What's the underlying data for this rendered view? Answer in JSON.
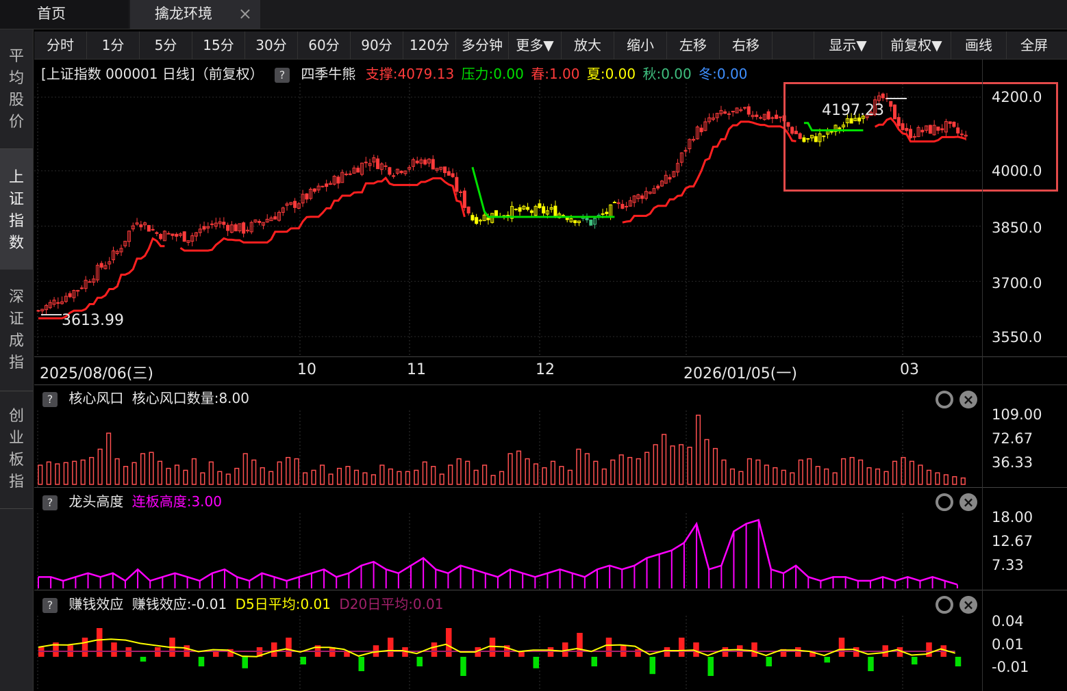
{
  "tabs": {
    "home": "首页",
    "active": "擒龙环境",
    "close": "×"
  },
  "leftnav": {
    "item1": [
      "平",
      "均",
      "股",
      "价"
    ],
    "item2": [
      "上",
      "证",
      "指",
      "数"
    ],
    "item3": [
      "深",
      "证",
      "成",
      "指"
    ],
    "item4": [
      "创",
      "业",
      "板",
      "指"
    ]
  },
  "toolbar": [
    "分时",
    "1分",
    "5分",
    "15分",
    "30分",
    "60分",
    "90分",
    "120分",
    "多分钟",
    "更多▼",
    "放大",
    "缩小",
    "左移",
    "右移",
    "",
    "显示▼",
    "前复权▼",
    "画线",
    "全屏"
  ],
  "main": {
    "title": "[上证指数 000001 日线]（前复权）",
    "indicator": "四季牛熊",
    "support": "支撑:4079.13",
    "pressure": "压力:0.00",
    "spring": "春:1.00",
    "summer": "夏:0.00",
    "autumn": "秋:0.00",
    "winter": "冬:0.00",
    "high_label": "4197.23",
    "low_label": "3613.99",
    "y_ticks": [
      "4200.0",
      "4000.0",
      "3850.0",
      "3700.0",
      "3550.0"
    ],
    "dates": [
      "2025/08/06(三)",
      "10",
      "11",
      "12",
      "2026/01/05(一)",
      "03"
    ]
  },
  "panel1": {
    "name": "核心风口",
    "value": "核心风口数量:8.00",
    "y_ticks": [
      "109.00",
      "72.67",
      "36.33"
    ]
  },
  "panel2": {
    "name": "龙头高度",
    "value": "连板高度:3.00",
    "y_ticks": [
      "18.00",
      "12.67",
      "7.33"
    ]
  },
  "panel3": {
    "name": "赚钱效应",
    "value": "赚钱效应:-0.01",
    "d5": "D5日平均:0.01",
    "d20": "D20日平均:0.01",
    "y_ticks": [
      "0.04",
      "0.01",
      "-0.01"
    ]
  },
  "colors": {
    "up": "#ff3b3b",
    "yellow": "#ffff00",
    "green": "#00e000",
    "magenta": "#ff00ff",
    "cyan": "#3fbfbf",
    "blue": "#3f8fff",
    "highlight": "#e34a4a"
  },
  "chart_data": [
    {
      "type": "candlestick",
      "title": "[上证指数 000001 日线]（前复权）",
      "ylim": [
        3550,
        4200
      ],
      "x_ticks": [
        "2025/08/06(三)",
        "10",
        "11",
        "12",
        "2026/01/05(一)",
        "03"
      ],
      "points": [
        {
          "i": 0,
          "v": 3620
        },
        {
          "i": 10,
          "v": 3680
        },
        {
          "i": 20,
          "v": 3780
        },
        {
          "i": 25,
          "v": 3870
        },
        {
          "i": 30,
          "v": 3830
        },
        {
          "i": 38,
          "v": 3820
        },
        {
          "i": 45,
          "v": 3860
        },
        {
          "i": 52,
          "v": 3840
        },
        {
          "i": 60,
          "v": 3880
        },
        {
          "i": 68,
          "v": 3930
        },
        {
          "i": 76,
          "v": 3980
        },
        {
          "i": 84,
          "v": 4030
        },
        {
          "i": 90,
          "v": 4000
        },
        {
          "i": 98,
          "v": 4030
        },
        {
          "i": 104,
          "v": 3990
        },
        {
          "i": 110,
          "v": 3870
        },
        {
          "i": 120,
          "v": 3890
        },
        {
          "i": 130,
          "v": 3890
        },
        {
          "i": 140,
          "v": 3860
        },
        {
          "i": 146,
          "v": 3900
        },
        {
          "i": 152,
          "v": 3930
        },
        {
          "i": 160,
          "v": 3980
        },
        {
          "i": 166,
          "v": 4100
        },
        {
          "i": 172,
          "v": 4150
        },
        {
          "i": 180,
          "v": 4160
        },
        {
          "i": 188,
          "v": 4140
        },
        {
          "i": 194,
          "v": 4080
        },
        {
          "i": 200,
          "v": 4100
        },
        {
          "i": 208,
          "v": 4150
        },
        {
          "i": 214,
          "v": 4197
        },
        {
          "i": 220,
          "v": 4100
        },
        {
          "i": 230,
          "v": 4120
        },
        {
          "i": 235,
          "v": 4090
        }
      ]
    },
    {
      "type": "bar",
      "title": "核心风口",
      "ylim": [
        0,
        109
      ],
      "values": [
        30,
        35,
        32,
        34,
        36,
        38,
        42,
        55,
        80,
        40,
        28,
        34,
        48,
        50,
        36,
        25,
        30,
        22,
        40,
        18,
        35,
        20,
        16,
        25,
        48,
        38,
        26,
        20,
        35,
        42,
        40,
        18,
        22,
        30,
        16,
        25,
        28,
        22,
        18,
        15,
        30,
        24,
        20,
        20,
        22,
        35,
        28,
        16,
        30,
        40,
        36,
        22,
        30,
        14,
        20,
        48,
        52,
        40,
        32,
        26,
        36,
        28,
        22,
        55,
        48,
        36,
        24,
        38,
        46,
        42,
        40,
        50,
        62,
        78,
        60,
        62,
        58,
        108,
        70,
        56,
        38,
        24,
        20,
        40,
        38,
        30,
        26,
        22,
        18,
        38,
        40,
        28,
        24,
        18,
        40,
        42,
        38,
        26,
        24,
        20,
        36,
        42,
        36,
        30,
        22,
        18,
        15,
        12,
        10
      ]
    },
    {
      "type": "bar",
      "title": "龙头高度",
      "ylim": [
        0,
        18
      ],
      "values": [
        3,
        3,
        2,
        3,
        4,
        3,
        4,
        2,
        5,
        2,
        3,
        4,
        3,
        2,
        4,
        5,
        3,
        2,
        4,
        3,
        2,
        3,
        4,
        5,
        3,
        4,
        6,
        7,
        5,
        4,
        6,
        8,
        5,
        4,
        6,
        5,
        4,
        3,
        5,
        4,
        3,
        4,
        5,
        4,
        3,
        5,
        6,
        5,
        6,
        8,
        9,
        10,
        12,
        17,
        5,
        6,
        15,
        17,
        18,
        5,
        4,
        6,
        3,
        2,
        3,
        3,
        2,
        2,
        3,
        2,
        3,
        2,
        3,
        2,
        1
      ]
    },
    {
      "type": "bar",
      "title": "赚钱效应",
      "ylim": [
        -0.02,
        0.04
      ],
      "values": [
        0.01,
        0.015,
        0.012,
        0.02,
        0.03,
        0.015,
        0.01,
        -0.005,
        0.01,
        0.02,
        0.012,
        -0.01,
        0.005,
        0.008,
        -0.012,
        0.01,
        0.015,
        0.02,
        -0.008,
        0.012,
        0.01,
        0.005,
        -0.015,
        0.012,
        0.02,
        0.01,
        -0.01,
        0.015,
        0.03,
        -0.02,
        0.01,
        0.02,
        0.012,
        0.005,
        -0.012,
        0.01,
        0.015,
        0.025,
        -0.01,
        0.02,
        0.012,
        0.008,
        -0.018,
        0.01,
        0.02,
        0.015,
        -0.02,
        0.01,
        0.012,
        0.015,
        -0.01,
        0.008,
        0.01,
        0.005,
        -0.006,
        0.02,
        0.01,
        -0.015,
        0.012,
        0.01,
        -0.008,
        0.015,
        0.012,
        -0.01
      ]
    }
  ]
}
